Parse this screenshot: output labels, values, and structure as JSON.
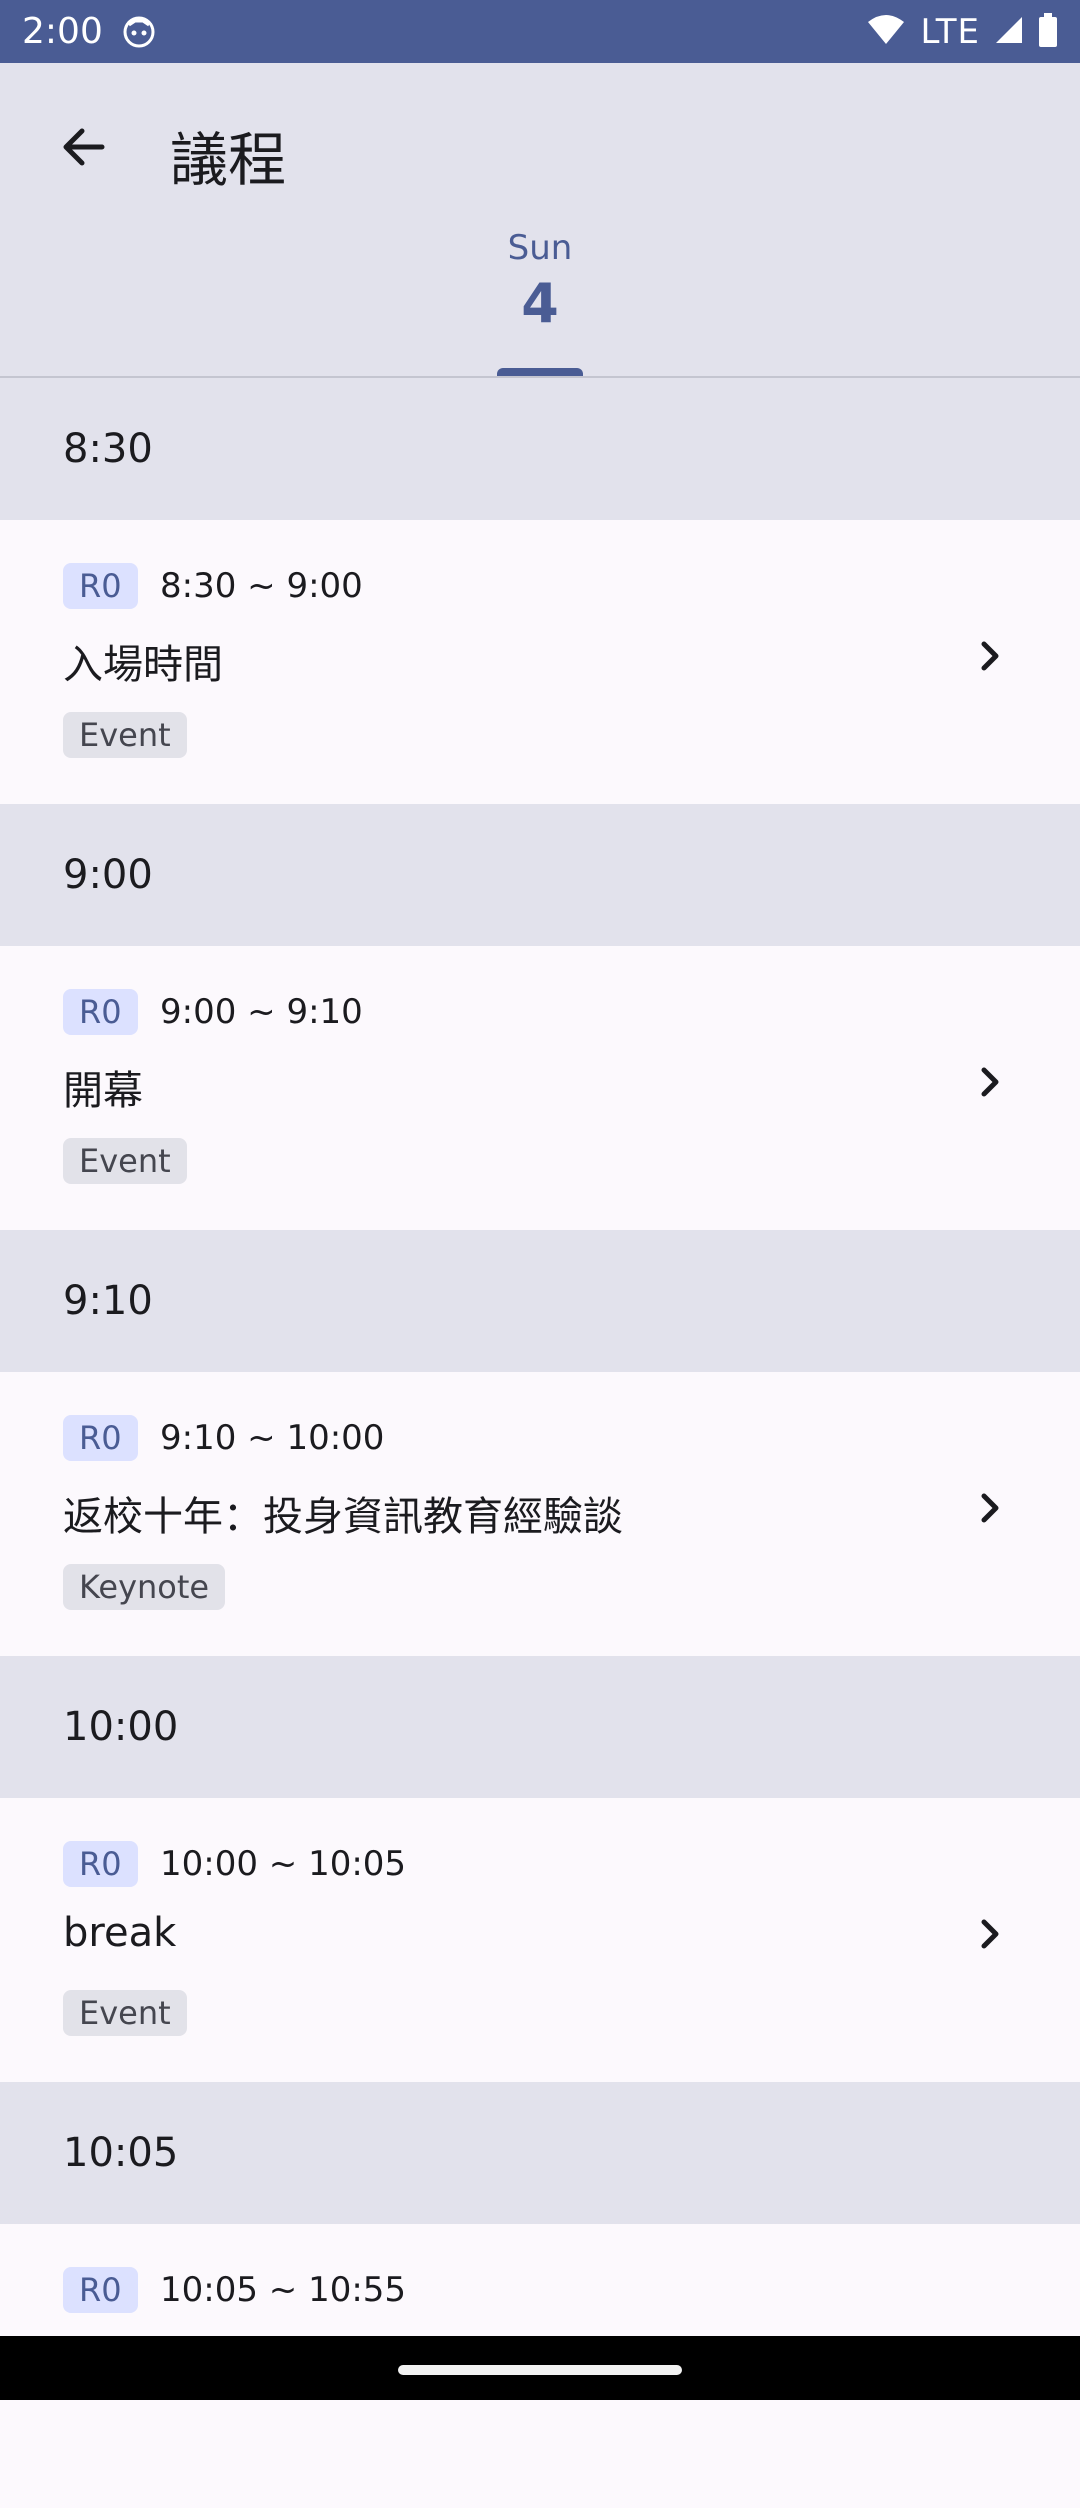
{
  "status_bar": {
    "time": "2:00",
    "network": "LTE"
  },
  "app_bar": {
    "title": "議程"
  },
  "day_tab": {
    "day_of_week": "Sun",
    "day": "4"
  },
  "colors": {
    "primary": "#4a5c94",
    "surface": "#fcf9fd",
    "section_bg": "#e2e2ec",
    "room_badge_bg": "#dce1ff"
  },
  "groups": [
    {
      "time": "8:30",
      "session": {
        "room": "R0",
        "range": "8:30 ~ 9:00",
        "title": "入場時間",
        "type": "Event"
      }
    },
    {
      "time": "9:00",
      "session": {
        "room": "R0",
        "range": "9:00 ~ 9:10",
        "title": "開幕",
        "type": "Event"
      }
    },
    {
      "time": "9:10",
      "session": {
        "room": "R0",
        "range": "9:10 ~ 10:00",
        "title": "返校十年：投身資訊教育經驗談",
        "type": "Keynote"
      }
    },
    {
      "time": "10:00",
      "session": {
        "room": "R0",
        "range": "10:00 ~ 10:05",
        "title": "break",
        "type": "Event"
      }
    },
    {
      "time": "10:05",
      "session": {
        "room": "R0",
        "range": "10:05 ~ 10:55"
      }
    }
  ]
}
